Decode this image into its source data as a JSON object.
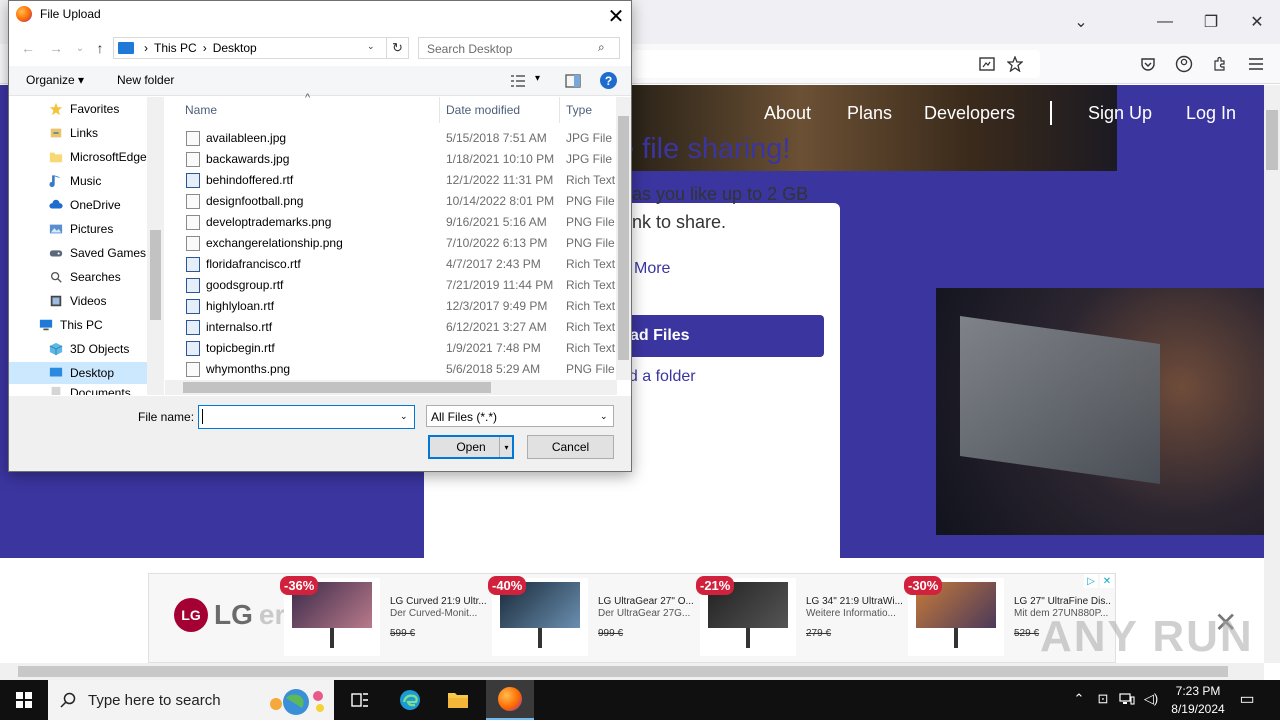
{
  "browser": {
    "controls": {
      "dropdown": "⌄",
      "minimize": "—",
      "restore": "❐",
      "close": "✕"
    },
    "toolbar_icons": [
      "reader-icon",
      "bookmark-star-icon",
      "pocket-icon",
      "account-icon",
      "extensions-icon",
      "menu-icon"
    ]
  },
  "website": {
    "nav": {
      "about": "About",
      "plans": "Plans",
      "developers": "Developers",
      "signup": "Sign Up",
      "login": "Log In"
    },
    "card": {
      "title": "e file sharing!",
      "text_line1": "as you like up to 2 GB",
      "text_line2": "nk to share.",
      "learn_more": "More",
      "upload_button": "ad Files",
      "upload_folder": "ad a folder"
    },
    "colors": {
      "brand": "#3b35a0"
    }
  },
  "ad": {
    "brand": "LG",
    "brand_extra": "erde",
    "items": [
      {
        "badge": "-36%",
        "name": "LG Curved 21:9 Ultr...",
        "sub": "Der Curved-Monit...",
        "price": "599 €"
      },
      {
        "badge": "-40%",
        "name": "LG UltraGear 27\" O...",
        "sub": "Der UltraGear 27G...",
        "price": "999 €"
      },
      {
        "badge": "-21%",
        "name": "LG 34\" 21:9 UltraWi...",
        "sub": "Weitere Informatio...",
        "price": "279 €"
      },
      {
        "badge": "-30%",
        "name": "LG 27\" UltraFine Dis...",
        "sub": "Mit dem 27UN880P...",
        "price": "529 €"
      }
    ],
    "adchoices": {
      "play": "▷",
      "close": "✕"
    },
    "close_icon": "✕",
    "watermark": "ANY RUN"
  },
  "dialog": {
    "title": "File Upload",
    "close": "✕",
    "nav": {
      "back": "←",
      "forward": "→",
      "recent": "⌄",
      "up": "↑"
    },
    "breadcrumb": [
      "This PC",
      "Desktop"
    ],
    "crumb_sep": "›",
    "refresh": "↻",
    "search_placeholder": "Search Desktop",
    "search_icon": "⌕",
    "toolbar": {
      "organize": "Organize ▾",
      "new_folder": "New folder",
      "view_dd": "▾",
      "help": "?"
    },
    "tree": [
      {
        "label": "Favorites",
        "icon": "star-icon"
      },
      {
        "label": "Links",
        "icon": "link-icon"
      },
      {
        "label": "MicrosoftEdge",
        "icon": "folder-icon"
      },
      {
        "label": "Music",
        "icon": "music-icon"
      },
      {
        "label": "OneDrive",
        "icon": "cloud-icon"
      },
      {
        "label": "Pictures",
        "icon": "pictures-icon"
      },
      {
        "label": "Saved Games",
        "icon": "games-icon"
      },
      {
        "label": "Searches",
        "icon": "search-icon"
      },
      {
        "label": "Videos",
        "icon": "video-icon"
      },
      {
        "label": "This PC",
        "icon": "computer-icon"
      },
      {
        "label": "3D Objects",
        "icon": "cube-icon"
      },
      {
        "label": "Desktop",
        "icon": "desktop-icon",
        "selected": true
      },
      {
        "label": "Documents",
        "icon": "documents-icon"
      }
    ],
    "columns": {
      "name": "Name",
      "date": "Date modified",
      "type": "Type"
    },
    "sort_arrow": "^",
    "files": [
      {
        "name": "availableen.jpg",
        "date": "5/15/2018 7:51 AM",
        "type": "JPG File",
        "kind": "img"
      },
      {
        "name": "backawards.jpg",
        "date": "1/18/2021 10:10 PM",
        "type": "JPG File",
        "kind": "img"
      },
      {
        "name": "behindoffered.rtf",
        "date": "12/1/2022 11:31 PM",
        "type": "Rich Text",
        "kind": "rtf"
      },
      {
        "name": "designfootball.png",
        "date": "10/14/2022 8:01 PM",
        "type": "PNG File",
        "kind": "img"
      },
      {
        "name": "developtrademarks.png",
        "date": "9/16/2021 5:16 AM",
        "type": "PNG File",
        "kind": "img"
      },
      {
        "name": "exchangerelationship.png",
        "date": "7/10/2022 6:13 PM",
        "type": "PNG File",
        "kind": "img"
      },
      {
        "name": "floridafrancisco.rtf",
        "date": "4/7/2017 2:43 PM",
        "type": "Rich Text",
        "kind": "rtf"
      },
      {
        "name": "goodsgroup.rtf",
        "date": "7/21/2019 11:44 PM",
        "type": "Rich Text",
        "kind": "rtf"
      },
      {
        "name": "highlyloan.rtf",
        "date": "12/3/2017 9:49 PM",
        "type": "Rich Text",
        "kind": "rtf"
      },
      {
        "name": "internalso.rtf",
        "date": "6/12/2021 3:27 AM",
        "type": "Rich Text",
        "kind": "rtf"
      },
      {
        "name": "topicbegin.rtf",
        "date": "1/9/2021 7:48 PM",
        "type": "Rich Text",
        "kind": "rtf"
      },
      {
        "name": "whymonths.png",
        "date": "5/6/2018 5:29 AM",
        "type": "PNG File",
        "kind": "img"
      }
    ],
    "filename_label": "File name:",
    "filename_value": "",
    "dd_arrow": "⌄",
    "filetype_value": "All Files (*.*)",
    "open_label": "Open",
    "open_split": "▾",
    "cancel_label": "Cancel"
  },
  "taskbar": {
    "search_placeholder": "Type here to search",
    "time": "7:23 PM",
    "date": "8/19/2024",
    "tray": {
      "chevron": "⌃",
      "network": "⊡",
      "volume": "◁)",
      "notifications": "▭"
    }
  }
}
